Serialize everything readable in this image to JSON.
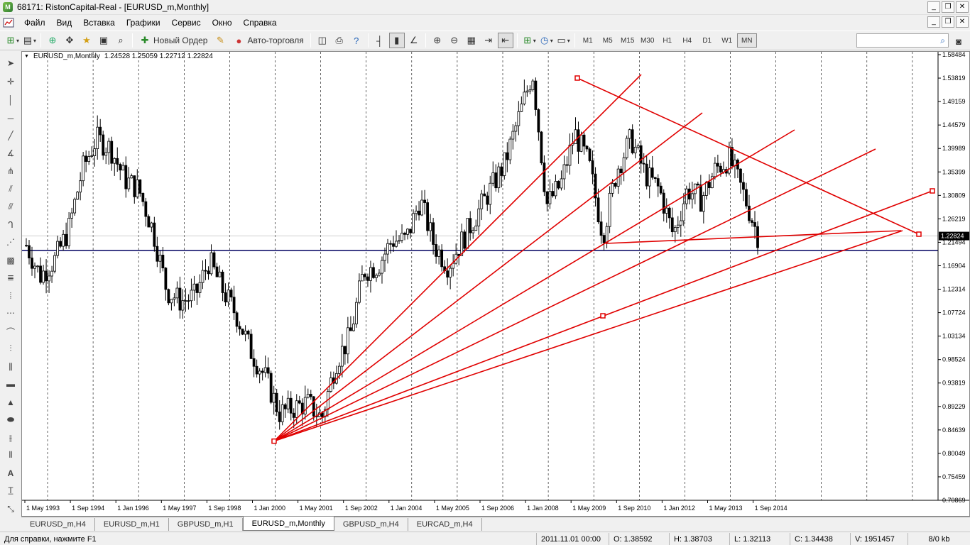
{
  "window": {
    "title": "68171: RistonCapital-Real - [EURUSD_m,Monthly]",
    "app_icon_glyph": "M",
    "controls": [
      "_",
      "❐",
      "✕"
    ]
  },
  "menu": [
    "Файл",
    "Вид",
    "Вставка",
    "Графики",
    "Сервис",
    "Окно",
    "Справка"
  ],
  "mdi_controls": [
    "_",
    "❐",
    "✕"
  ],
  "toolbar": {
    "new_order": "Новый Ордер",
    "auto_trading": "Авто-торговля",
    "timeframes": [
      "M1",
      "M5",
      "M15",
      "M30",
      "H1",
      "H4",
      "D1",
      "W1",
      "MN"
    ],
    "active_timeframe": "MN"
  },
  "chart": {
    "header": "EURUSD_m,Monthly  1.24528 1.25059 1.22712 1.22824",
    "symbol_label": "EURUSD_m,Monthly",
    "ohlc": "1.24528 1.25059 1.22712 1.22824",
    "current_price": "1.22824",
    "price_ticks": [
      "1.58484",
      "1.53819",
      "1.49159",
      "1.44579",
      "1.39989",
      "1.35399",
      "1.30809",
      "1.26219",
      "1.21494",
      "1.16904",
      "1.12314",
      "1.07724",
      "1.03134",
      "0.98524",
      "0.93819",
      "0.89229",
      "0.84639",
      "0.80049",
      "0.75459",
      "0.70869"
    ],
    "time_ticks": [
      "1 May 1993",
      "1 Sep 1994",
      "1 Jan 1996",
      "1 May 1997",
      "1 Sep 1998",
      "1 Jan 2000",
      "1 May 2001",
      "1 Sep 2002",
      "1 Jan 2004",
      "1 May 2005",
      "1 Sep 2006",
      "1 Jan 2008",
      "1 May 2009",
      "1 Sep 2010",
      "1 Jan 2012",
      "1 May 2013",
      "1 Sep 2014"
    ],
    "colors": {
      "candles": "#000000",
      "drawings": "#e00000",
      "hline": "#000060",
      "grid": "#000000"
    }
  },
  "chart_data": {
    "type": "candlestick",
    "title": "EURUSD_m,Monthly",
    "x": [
      "1993-05",
      "1993-10",
      "1994-03",
      "1994-08",
      "1995-01",
      "1995-06",
      "1995-11",
      "1996-04",
      "1996-09",
      "1997-02",
      "1997-07",
      "1997-12",
      "1998-05",
      "1998-10",
      "1999-03",
      "1999-08",
      "2000-01",
      "2000-06",
      "2000-11",
      "2001-04",
      "2001-09",
      "2002-02",
      "2002-07",
      "2002-12",
      "2003-05",
      "2003-10",
      "2004-03",
      "2004-08",
      "2005-01",
      "2005-06",
      "2005-11",
      "2006-04",
      "2006-09",
      "2007-02",
      "2007-07",
      "2007-12",
      "2008-05",
      "2008-10",
      "2009-03",
      "2009-08",
      "2010-01",
      "2010-06",
      "2010-11",
      "2011-04",
      "2011-09",
      "2012-02",
      "2012-07",
      "2012-12",
      "2013-05",
      "2013-10",
      "2014-03",
      "2014-08",
      "2014-11"
    ],
    "close": [
      1.21,
      1.15,
      1.18,
      1.24,
      1.36,
      1.42,
      1.4,
      1.34,
      1.32,
      1.24,
      1.12,
      1.1,
      1.11,
      1.18,
      1.12,
      1.07,
      1.0,
      0.95,
      0.88,
      0.89,
      0.9,
      0.87,
      0.98,
      1.03,
      1.16,
      1.17,
      1.22,
      1.22,
      1.3,
      1.21,
      1.17,
      1.22,
      1.27,
      1.32,
      1.37,
      1.46,
      1.55,
      1.29,
      1.33,
      1.43,
      1.37,
      1.23,
      1.36,
      1.42,
      1.35,
      1.32,
      1.23,
      1.32,
      1.3,
      1.36,
      1.38,
      1.31,
      1.23
    ],
    "ylim": [
      0.70869,
      1.58484
    ],
    "horizontal_line": 1.2
  },
  "tabs": [
    "EURUSD_m,H4",
    "EURUSD_m,H1",
    "GBPUSD_m,H1",
    "EURUSD_m,Monthly",
    "GBPUSD_m,H4",
    "EURCAD_m,H4"
  ],
  "active_tab": "EURUSD_m,Monthly",
  "status": {
    "help": "Для справки, нажмите F1",
    "datetime": "2011.11.01 00:00",
    "open": "O: 1.38592",
    "high": "H: 1.38703",
    "low": "L: 1.32113",
    "close": "C: 1.34438",
    "volume": "V: 1951457",
    "traffic": "8/0 kb"
  }
}
